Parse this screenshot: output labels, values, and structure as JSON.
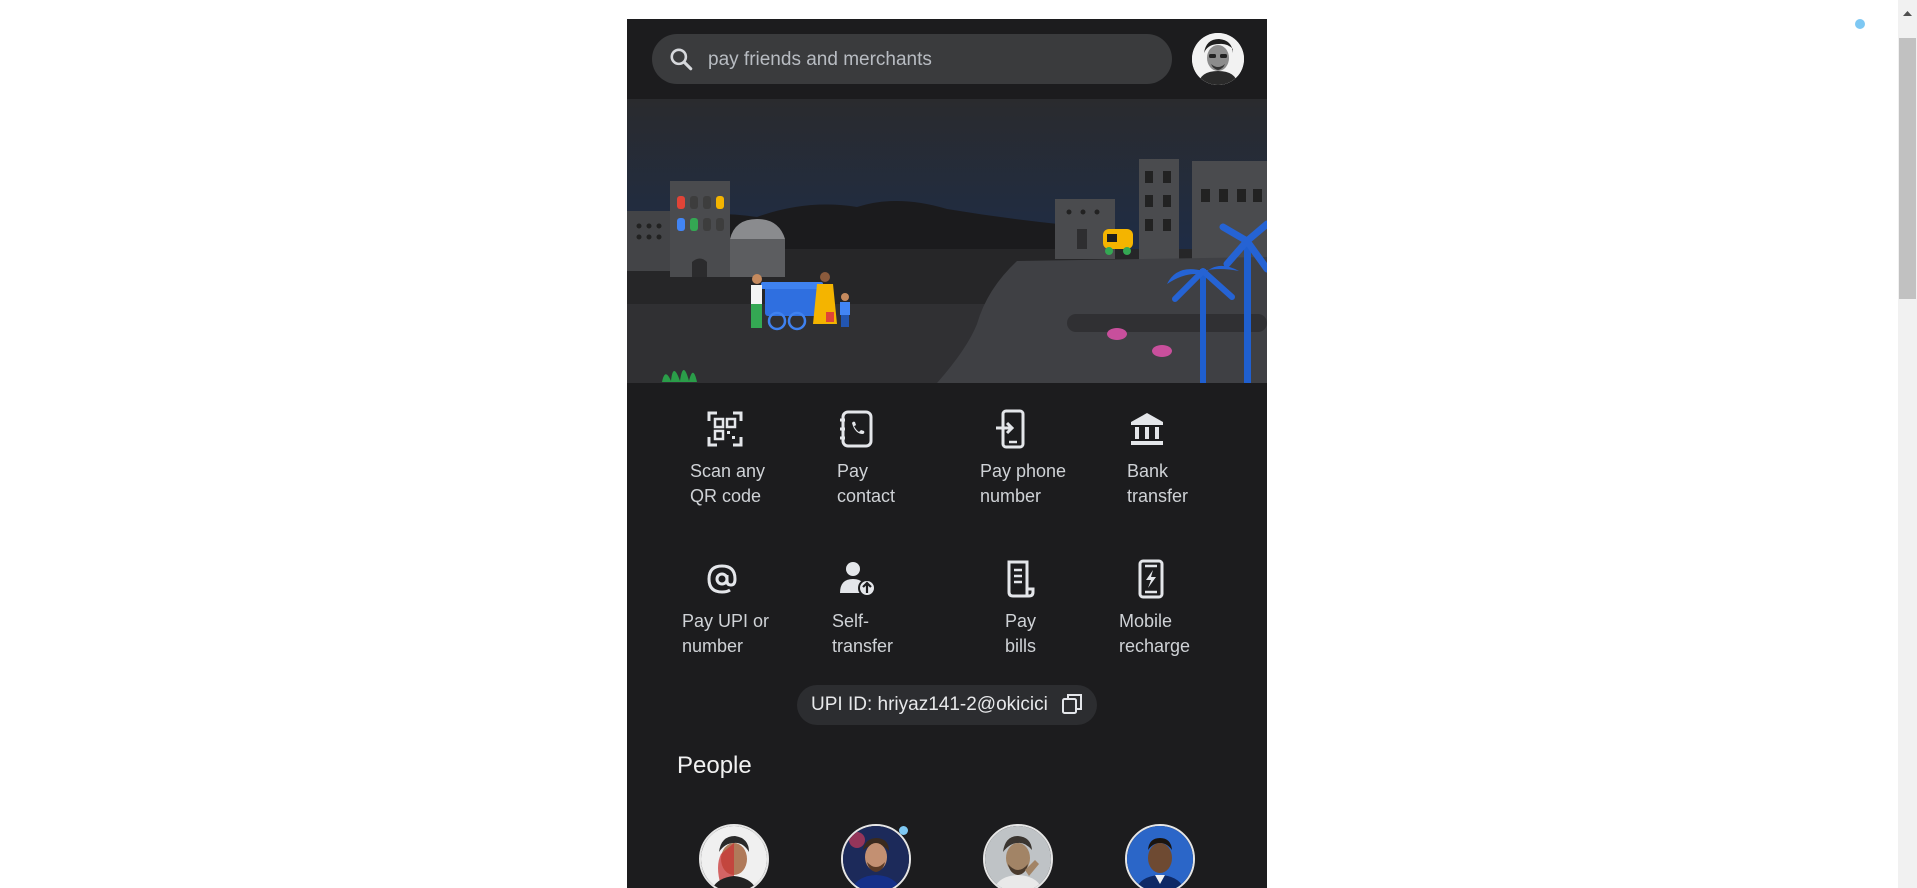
{
  "search": {
    "placeholder": "pay friends and merchants"
  },
  "actions": [
    {
      "id": "scan",
      "line1": "Scan any",
      "line2": "QR code",
      "icon": "qr-scan-icon"
    },
    {
      "id": "pay-contact",
      "line1": "Pay",
      "line2": "contact",
      "icon": "contact-book-icon"
    },
    {
      "id": "pay-phone",
      "line1": "Pay phone",
      "line2": "number",
      "icon": "phone-transfer-icon"
    },
    {
      "id": "bank",
      "line1": "Bank",
      "line2": "transfer",
      "icon": "bank-icon"
    },
    {
      "id": "pay-upi",
      "line1": "Pay UPI or",
      "line2": "number",
      "icon": "at-sign-icon"
    },
    {
      "id": "self",
      "line1": "Self-",
      "line2": "transfer",
      "icon": "self-transfer-icon"
    },
    {
      "id": "bills",
      "line1": "Pay",
      "line2": "bills",
      "icon": "bill-receipt-icon"
    },
    {
      "id": "recharge",
      "line1": "Mobile",
      "line2": "recharge",
      "icon": "mobile-recharge-icon"
    }
  ],
  "upi": {
    "label": "UPI ID: hriyaz141-2@okicici"
  },
  "people": {
    "title": "People"
  },
  "colors": {
    "app_bg": "#1c1c1e",
    "search_bg": "#3a3b3d",
    "notification_dot": "#7ec8f3"
  }
}
